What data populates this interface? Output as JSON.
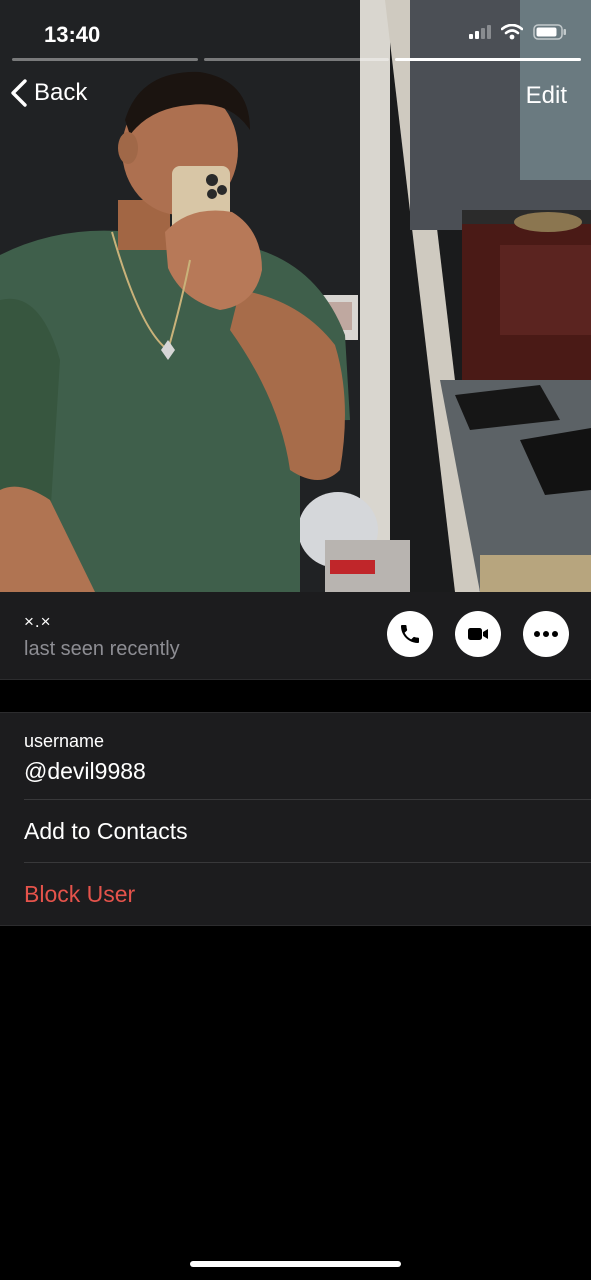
{
  "status_bar": {
    "time": "13:40"
  },
  "story": {
    "segments": 3,
    "active_segment_index": 2
  },
  "nav": {
    "back_label": "Back",
    "edit_label": "Edit"
  },
  "profile": {
    "name": "×.×",
    "last_seen": "last seen recently",
    "actions": [
      "phone-icon",
      "video-icon",
      "more-icon"
    ]
  },
  "info": {
    "username_label": "username",
    "username_value": "@devil9988",
    "add_contact_label": "Add to Contacts",
    "block_label": "Block User"
  },
  "colors": {
    "destructive": "#e5534b",
    "panel": "#1c1c1e",
    "muted_text": "#8d8d93"
  }
}
